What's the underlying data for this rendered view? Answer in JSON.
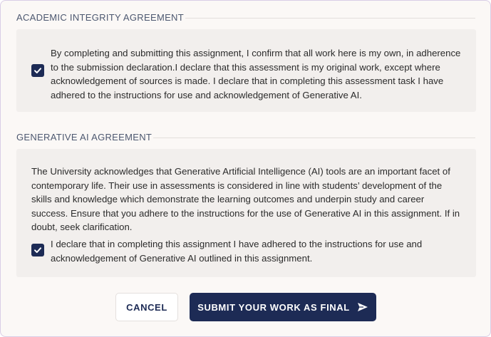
{
  "academic": {
    "heading": "ACADEMIC INTEGRITY AGREEMENT",
    "checked": true,
    "lines": [
      "By completing and submitting this assignment, I confirm that all work here is my own, in adherence",
      "to the submission declaration.I declare that this assessment is my original work, except where",
      "acknowledgement of sources is made. I declare that in completing this assessment task I have",
      "adhered to the instructions for use and acknowledgement of Generative AI."
    ]
  },
  "generative": {
    "heading": "GENERATIVE AI AGREEMENT",
    "intro_lines": [
      "The University acknowledges that Generative Artificial Intelligence (AI) tools are an important facet of",
      "contemporary life. Their use in assessments is considered in line with students’ development of the",
      "skills and knowledge which demonstrate the learning outcomes and underpin study and career",
      "success. Ensure that you adhere to the instructions for the use of Generative AI in this assignment. If in",
      "doubt, seek clarification."
    ],
    "checked": true,
    "declaration_lines": [
      "I declare that in completing this assignment I have adhered to the instructions for use and",
      "acknowledgement of Generative AI outlined in this assignment."
    ]
  },
  "actions": {
    "cancel_label": "CANCEL",
    "submit_label": "SUBMIT YOUR WORK AS FINAL",
    "submit_icon": "send-icon"
  },
  "colors": {
    "primary": "#1d2b55",
    "card": "#f2efed",
    "page": "#fbf8f6"
  }
}
